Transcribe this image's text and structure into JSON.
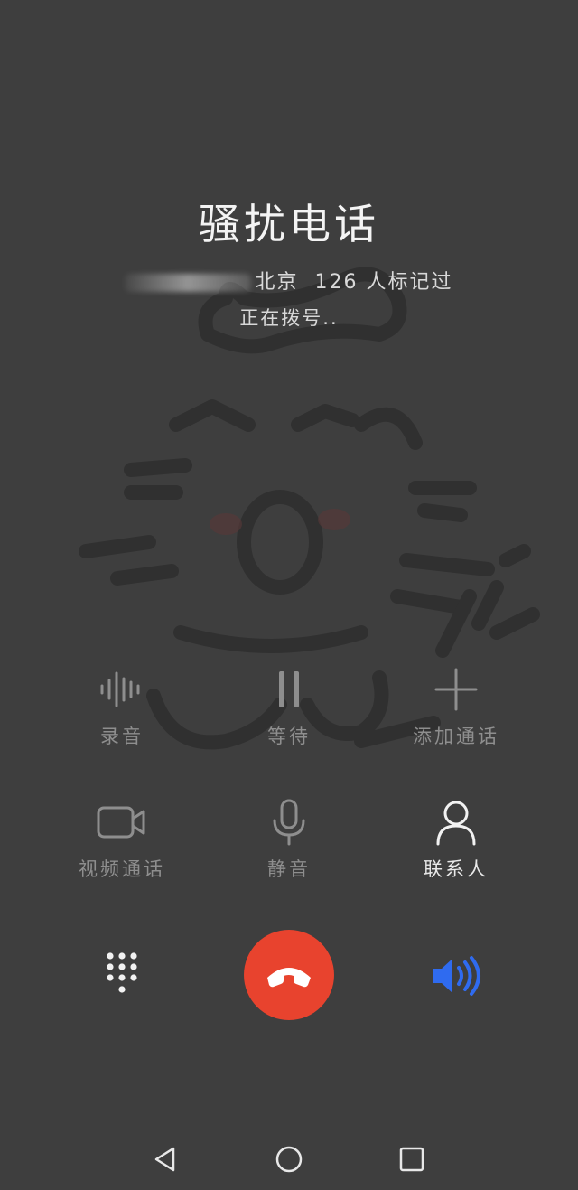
{
  "caller": {
    "title": "骚扰电话",
    "location": "北京",
    "mark_info": "126 人标记过",
    "status": "正在拨号.."
  },
  "controls_row1": [
    {
      "label": "录音",
      "icon": "waveform-icon"
    },
    {
      "label": "等待",
      "icon": "pause-icon"
    },
    {
      "label": "添加通话",
      "icon": "plus-icon"
    }
  ],
  "controls_row2": [
    {
      "label": "视频通话",
      "icon": "video-camera-icon"
    },
    {
      "label": "静音",
      "icon": "microphone-icon"
    },
    {
      "label": "联系人",
      "icon": "person-icon"
    }
  ],
  "bottom": {
    "dialpad_icon": "dialpad-icon",
    "end_call_icon": "hang-up-icon",
    "speaker_icon": "speaker-icon",
    "end_call_color": "#e8432e",
    "speaker_color": "#2f6bf0"
  },
  "navbar": [
    "back-icon",
    "home-icon",
    "recents-icon"
  ]
}
